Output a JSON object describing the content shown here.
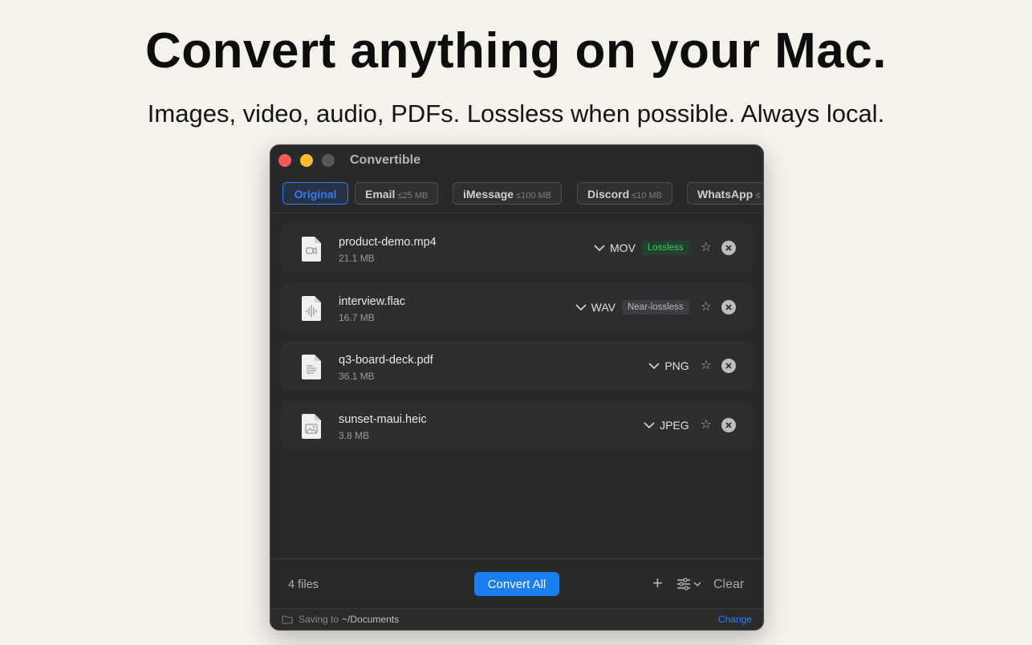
{
  "hero": {
    "headline": "Convert anything on your Mac.",
    "subhead": "Images, video, audio, PDFs. Lossless when possible. Always local."
  },
  "window": {
    "title": "Convertible",
    "tabs": [
      {
        "label": "Original",
        "limit": "",
        "active": true
      },
      {
        "label": "Email",
        "limit": "≤25 MB",
        "active": false
      },
      {
        "label": "iMessage",
        "limit": "≤100 MB",
        "active": false
      },
      {
        "label": "Discord",
        "limit": "≤10 MB",
        "active": false
      },
      {
        "label": "WhatsApp",
        "limit": "≤",
        "active": false
      }
    ],
    "files": [
      {
        "name": "product-demo.mp4",
        "size": "21.1 MB",
        "format": "MOV",
        "badge": "Lossless",
        "icon": "video-file-icon"
      },
      {
        "name": "interview.flac",
        "size": "16.7 MB",
        "format": "WAV",
        "badge": "Near-lossless",
        "icon": "audio-file-icon"
      },
      {
        "name": "q3-board-deck.pdf",
        "size": "36.1 MB",
        "format": "PNG",
        "badge": "",
        "icon": "document-file-icon"
      },
      {
        "name": "sunset-maui.heic",
        "size": "3.8 MB",
        "format": "JPEG",
        "badge": "",
        "icon": "image-file-icon"
      }
    ],
    "footer": {
      "count": "4 files",
      "convert_label": "Convert All",
      "clear_label": "Clear"
    },
    "status": {
      "saving_label": "Saving to",
      "path": "~/Documents",
      "change_label": "Change"
    }
  },
  "colors": {
    "accent": "#1a7ff5",
    "lossless": "#4bc66b",
    "window_bg": "#28292b"
  }
}
